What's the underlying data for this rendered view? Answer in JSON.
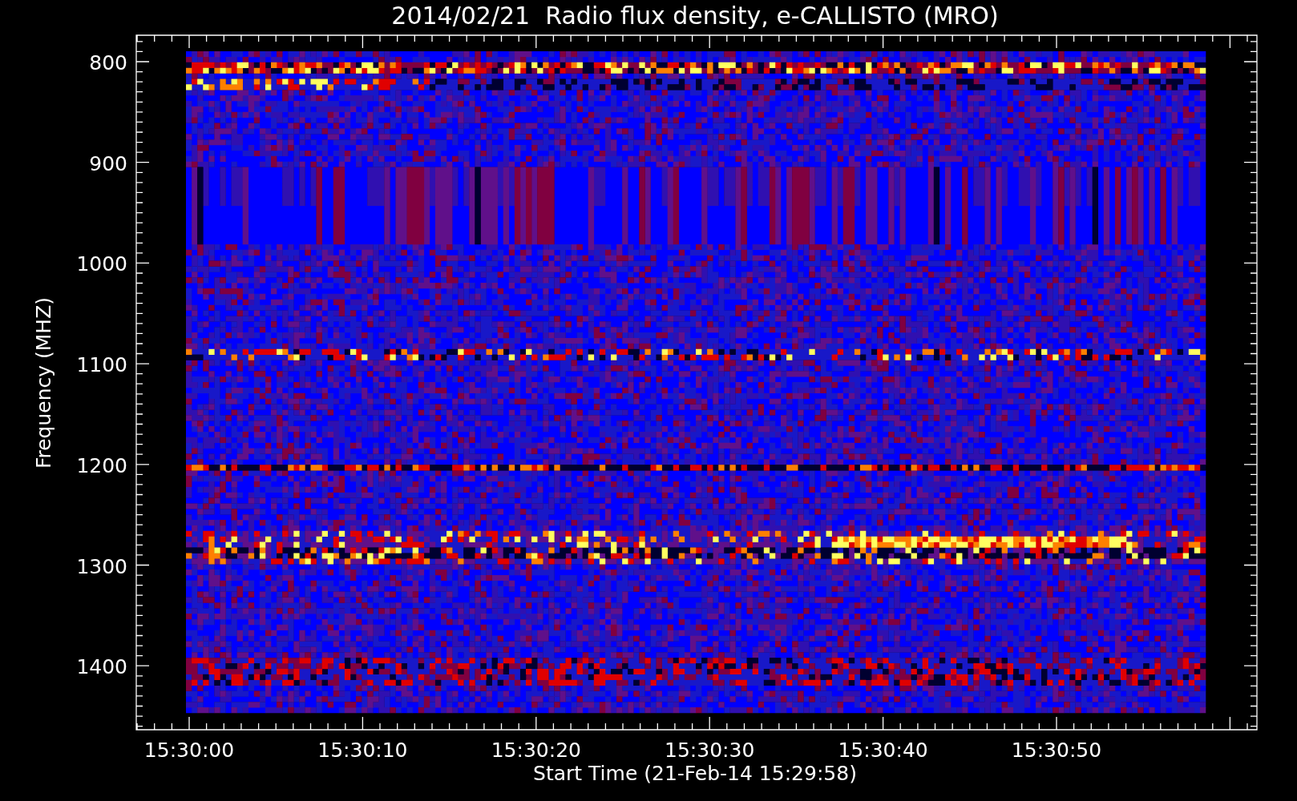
{
  "title": "2014/02/21  Radio flux density, e-CALLISTO (MRO)",
  "y_axis": {
    "label": "Frequency (MHZ)",
    "ticks": [
      "800",
      "900",
      "1000",
      "1100",
      "1200",
      "1300",
      "1400"
    ]
  },
  "x_axis": {
    "label": "Start Time (21-Feb-14 15:29:58)",
    "ticks": [
      "15:30:00",
      "15:30:10",
      "15:30:20",
      "15:30:30",
      "15:30:40",
      "15:30:50"
    ]
  }
}
